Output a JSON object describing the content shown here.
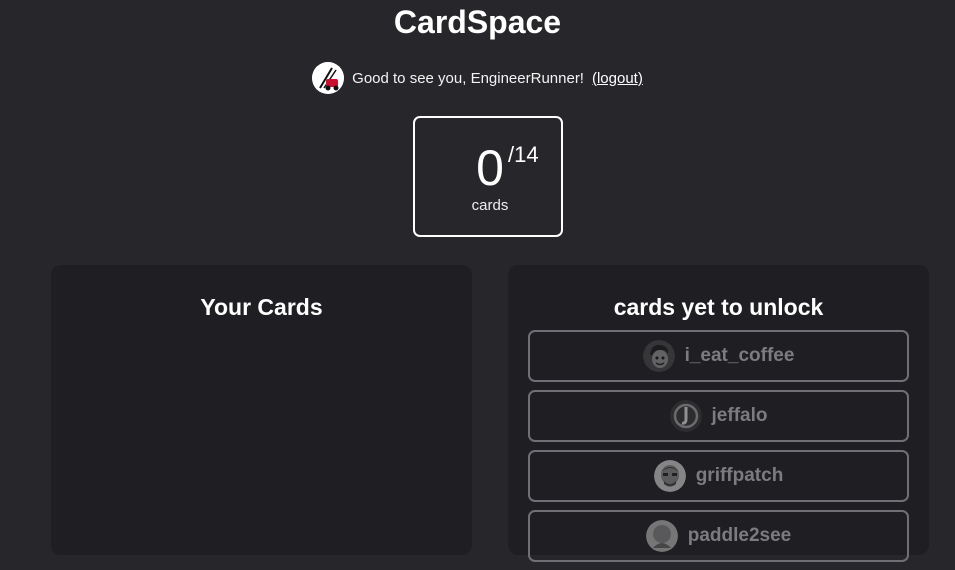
{
  "app": {
    "title": "CardSpace"
  },
  "greeting": {
    "text": "Good to see you, EngineerRunner!",
    "logout_label": "(logout)"
  },
  "counter": {
    "count": "0",
    "total": "/14",
    "label": "cards"
  },
  "your_cards": {
    "title": "Your Cards"
  },
  "unlock": {
    "title": "cards yet to unlock",
    "cards": [
      {
        "name": "i_eat_coffee"
      },
      {
        "name": "jeffalo"
      },
      {
        "name": "griffpatch"
      },
      {
        "name": "paddle2see"
      }
    ]
  },
  "colors": {
    "background": "#27272b",
    "panel": "#1f1f23",
    "card_border": "#6f6f75",
    "locked_text": "#7b7b80"
  }
}
